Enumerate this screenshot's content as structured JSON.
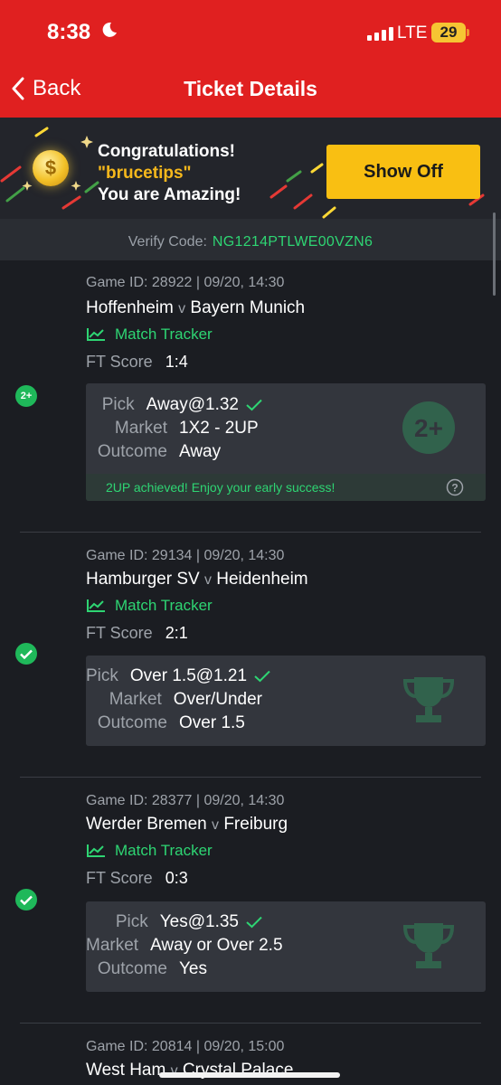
{
  "status_bar": {
    "time": "8:38",
    "network": "LTE",
    "battery": "29"
  },
  "nav": {
    "back_label": "Back",
    "title": "Ticket Details"
  },
  "banner": {
    "line1": "Congratulations!",
    "username": "\"brucetips\"",
    "line3": "You are Amazing!",
    "show_off_label": "Show Off"
  },
  "verify": {
    "label": "Verify Code:",
    "code": "NG1214PTLWE00VZN6"
  },
  "labels": {
    "match_tracker": "Match Tracker",
    "ft_score": "FT Score",
    "pick": "Pick",
    "market": "Market",
    "outcome": "Outcome",
    "v": "v"
  },
  "games": [
    {
      "game_id_line": "Game ID: 28922 | 09/20, 14:30",
      "home": "Hoffenheim",
      "away": "Bayern Munich",
      "ft_score": "1:4",
      "pick": "Away@1.32",
      "market": "1X2 - 2UP",
      "outcome": "Away",
      "badge": "2+",
      "note": "2UP achieved! Enjoy your early success!"
    },
    {
      "game_id_line": "Game ID: 29134 | 09/20, 14:30",
      "home": "Hamburger SV",
      "away": "Heidenheim",
      "ft_score": "2:1",
      "pick": "Over 1.5@1.21",
      "market": "Over/Under",
      "outcome": "Over 1.5"
    },
    {
      "game_id_line": "Game ID: 28377 | 09/20, 14:30",
      "home": "Werder Bremen",
      "away": "Freiburg",
      "ft_score": "0:3",
      "pick": "Yes@1.35",
      "market": "Away or Over 2.5",
      "outcome": "Yes"
    },
    {
      "game_id_line": "Game ID: 20814 | 09/20, 15:00",
      "home": "West Ham",
      "away": "Crystal Palace"
    }
  ],
  "colors": {
    "header_red": "#e02020",
    "accent_green": "#2ed573",
    "button_yellow": "#f9bf12",
    "username_orange": "#f6b81c",
    "background": "#1b1d22"
  }
}
